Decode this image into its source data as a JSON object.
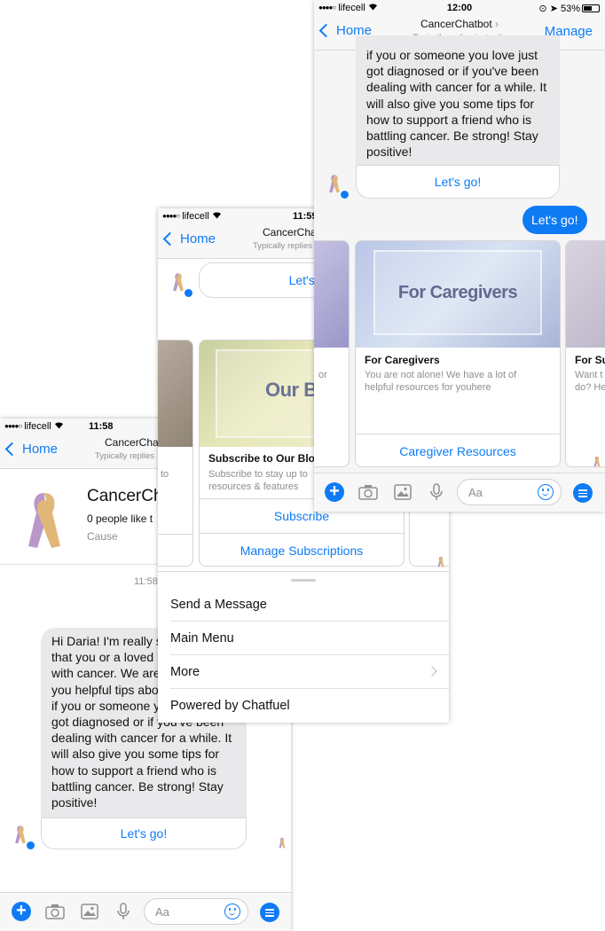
{
  "status": {
    "carrier": "lifecell",
    "time_left": "11:58",
    "time_mid": "11:59",
    "time_right": "12:00",
    "battery": "53%"
  },
  "nav": {
    "back_label": "Home",
    "title": "CancerChatbot",
    "title_short": "CancerCha",
    "subtitle": "Typically replies instantly",
    "subtitle_short": "Typically replies",
    "manage_label": "Manage"
  },
  "profile": {
    "name": "CancerChatbot",
    "name_visible": "CancerCha",
    "likes": "0 people like this",
    "likes_visible": "0 people like t",
    "category": "Cause",
    "timestamp": "11:58"
  },
  "intro_lines_left": [
    "Hi Daria! I'm really s",
    "that you or a loved",
    "with cancer. We are",
    "you helpful tips abo",
    "if you or someone y",
    "got diagnosed or if you've been",
    "dealing with cancer for a while. It",
    "will also give you some tips for",
    "how to support a friend who is",
    "battling cancer. Be strong! Stay",
    "positive!"
  ],
  "intro_lines_right": [
    "if you or someone you love just",
    "got diagnosed or if you've been",
    "dealing with cancer for a while. It",
    "will also give you some tips for",
    "how to support a friend who is",
    "battling cancer. Be strong! Stay",
    "positive!"
  ],
  "lets_go": "Let's go!",
  "lets_go_partial": "Let's g",
  "user_reply": "Let's go!",
  "cards_mid": {
    "image_text": "Our Bl",
    "title": "Subscribe to Our Blo",
    "desc_line1": "Subscribe to stay up to",
    "desc_line2": "resources & features",
    "button1": "Subscribe",
    "button2": "Manage Subscriptions",
    "left_desc": "to"
  },
  "cards_right": {
    "image_text": "For Caregivers",
    "title": "For Caregivers",
    "desc": "You are not alone! We have a lot of helpful resources for youhere",
    "button": "Caregiver Resources",
    "left_desc": "or",
    "next_title": "For Su",
    "next_desc1": "Want t",
    "next_desc2": "do? He"
  },
  "menu": {
    "items": [
      "Send a Message",
      "Main Menu",
      "More",
      "Powered by Chatfuel"
    ]
  },
  "composer": {
    "placeholder": "Aa"
  },
  "colors": {
    "accent": "#0e7bf5",
    "bubble": "#e9e9eb",
    "divider": "#d9d9dc"
  }
}
